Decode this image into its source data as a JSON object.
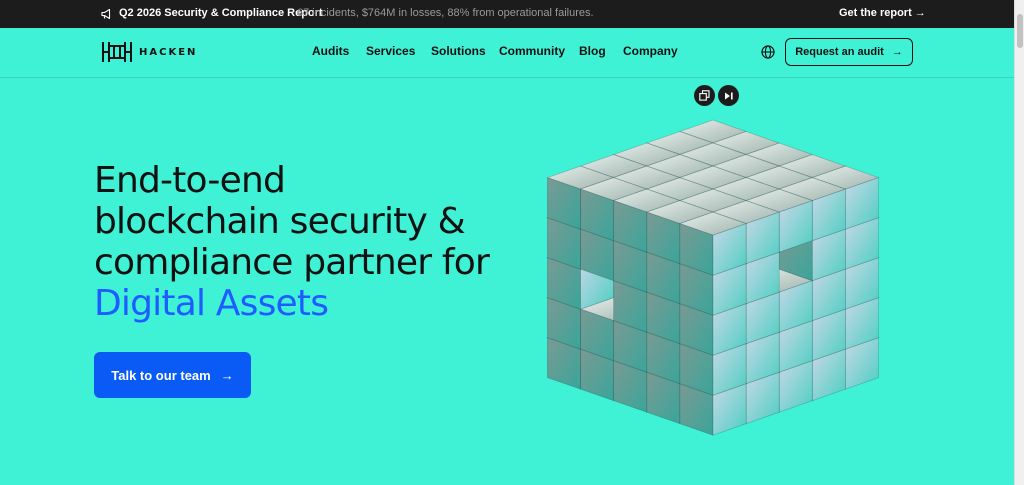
{
  "announcement": {
    "icon": "megaphone-icon",
    "title": "Q2 2026 Security & Compliance Report",
    "description": "67 incidents, $764M in losses, 88% from operational failures.",
    "link_label": "Get the report",
    "link_arrow": "→"
  },
  "header": {
    "logo_text": "HACKEN",
    "nav": [
      "Audits",
      "Services",
      "Solutions",
      "Community",
      "Blog",
      "Company"
    ],
    "language_icon": "globe-icon",
    "request_audit_label": "Request an audit",
    "request_audit_arrow": "→"
  },
  "hero": {
    "title_line1": "End-to-end",
    "title_line2": "blockchain security &",
    "title_line3": "compliance partner for",
    "title_accent": "Digital Assets",
    "cta_label": "Talk to our team",
    "cta_arrow": "→"
  },
  "media_controls": {
    "pip_icon": "picture-in-picture-icon",
    "skip_icon": "skip-forward-icon"
  },
  "colors": {
    "background": "#3ff2d6",
    "topbar": "#1c1c1c",
    "accent_text": "#1f5cff",
    "cta_background": "#0a5bf5",
    "muted_text": "#9a9a9a"
  }
}
